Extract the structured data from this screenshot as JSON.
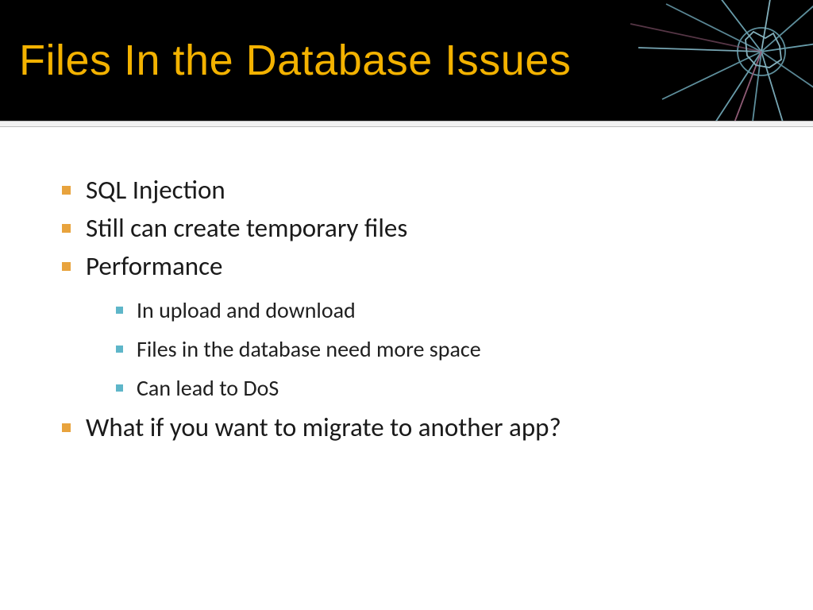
{
  "header": {
    "title": "Files In the Database Issues"
  },
  "bullets": [
    {
      "text": "SQL Injection",
      "children": []
    },
    {
      "text": "Still can create temporary files",
      "children": []
    },
    {
      "text": "Performance",
      "children": [
        {
          "text": "In upload and download"
        },
        {
          "text": "Files in the database need more space"
        },
        {
          "text": "Can lead to DoS"
        }
      ]
    },
    {
      "text": "What if you want to migrate to another app?",
      "children": []
    }
  ]
}
